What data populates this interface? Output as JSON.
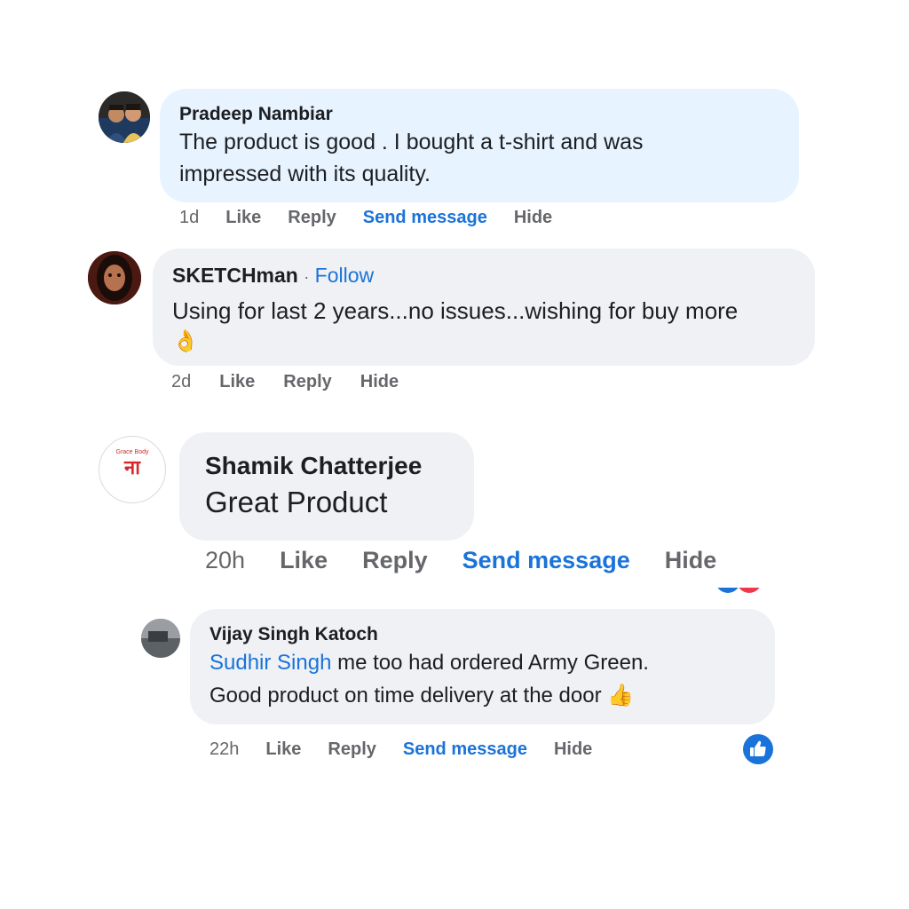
{
  "comments": [
    {
      "author": "Pradeep Nambiar",
      "text_line1": "The product is good . I bought a t-shirt and was",
      "text_line2": "impressed with its quality.",
      "time": "1d",
      "like": "Like",
      "reply": "Reply",
      "send_message": "Send message",
      "hide": "Hide"
    },
    {
      "author": "SKETCHman",
      "separator": "·",
      "follow": "Follow",
      "text_line1": "Using for last 2 years...no issues...wishing for buy more",
      "emoji": "👌",
      "time": "2d",
      "like": "Like",
      "reply": "Reply",
      "hide": "Hide"
    },
    {
      "author": "Shamik Chatterjee",
      "avatar_text_top": "Grace Body",
      "avatar_text_main": "ना",
      "text_line1": "Great Product",
      "time": "20h",
      "like": "Like",
      "reply": "Reply",
      "send_message": "Send message",
      "hide": "Hide"
    },
    {
      "author": "Vijay Singh Katoch",
      "mention": "Sudhir Singh",
      "text_line1_rest": " me too had ordered Army Green.",
      "text_line2": "Good product on time delivery at the door",
      "emoji": "👍",
      "time": "22h",
      "like": "Like",
      "reply": "Reply",
      "send_message": "Send message",
      "hide": "Hide",
      "reaction": "like-reaction"
    }
  ],
  "colors": {
    "link": "#1a73d9",
    "bubble_gray": "#eff1f4",
    "bubble_blue": "#e7f3ff",
    "action_gray": "#65676b"
  }
}
